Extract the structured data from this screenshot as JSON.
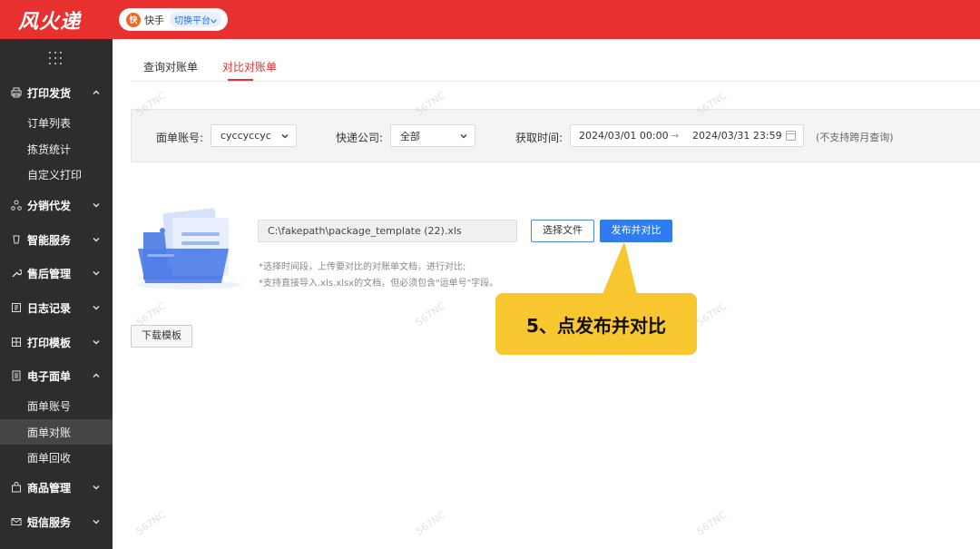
{
  "brand": {
    "logo": "风火递"
  },
  "platform": {
    "icon_text": "快",
    "name": "快手",
    "switch_label": "切换平台"
  },
  "sidebar": {
    "groups": [
      {
        "icon": "printer-icon",
        "label": "打印发货",
        "expanded": true,
        "items": [
          "订单列表",
          "拣货统计",
          "自定义打印"
        ]
      },
      {
        "icon": "distribution-icon",
        "label": "分销代发",
        "expanded": false
      },
      {
        "icon": "smart-service-icon",
        "label": "智能服务",
        "expanded": false
      },
      {
        "icon": "wrench-icon",
        "label": "售后管理",
        "expanded": false
      },
      {
        "icon": "log-icon",
        "label": "日志记录",
        "expanded": false
      },
      {
        "icon": "template-icon",
        "label": "打印模板",
        "expanded": false
      },
      {
        "icon": "document-icon",
        "label": "电子面单",
        "expanded": true,
        "items": [
          "面单账号",
          "面单对账",
          "面单回收"
        ],
        "active_item": "面单对账"
      },
      {
        "icon": "bag-icon",
        "label": "商品管理",
        "expanded": false
      },
      {
        "icon": "mail-icon",
        "label": "短信服务",
        "expanded": false
      }
    ]
  },
  "tabs": [
    {
      "label": "查询对账单",
      "active": false
    },
    {
      "label": "对比对账单",
      "active": true
    }
  ],
  "filters": {
    "account_label": "面单账号:",
    "account_value": "cyccyccyc",
    "courier_label": "快递公司:",
    "courier_value": "全部",
    "time_label": "获取时间:",
    "time_start": "2024/03/01 00:00",
    "time_arrow": "→",
    "time_end": "2024/03/31 23:59",
    "time_hint": "(不支持跨月查询)"
  },
  "upload": {
    "file_path": "C:\\fakepath\\package_template (22).xls",
    "choose_label": "选择文件",
    "publish_label": "发布并对比",
    "notes": [
      "*选择时间段，上传要对比的对账单文档，进行对比;",
      "*支持直接导入.xls.xlsx的文档，但必须包含\"运单号\"字段。"
    ]
  },
  "download_label": "下载模板",
  "callout": {
    "text": "5、点发布并对比"
  },
  "watermark": "567NC",
  "colors": {
    "brand_red": "#e8312f",
    "primary_blue": "#2f7bf0",
    "sidebar_bg": "#2d2d2d",
    "callout_yellow": "#f8c62f"
  }
}
